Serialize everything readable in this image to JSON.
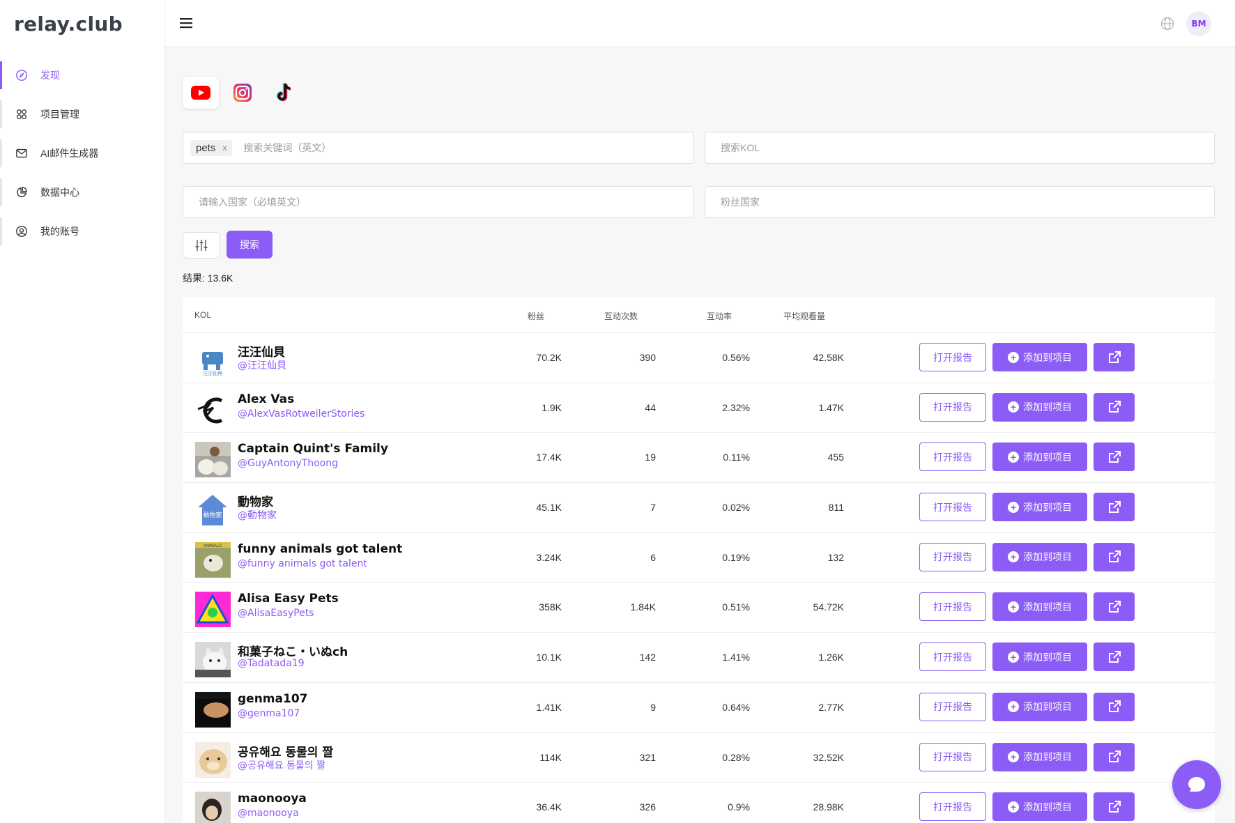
{
  "app": {
    "logo": "relay.club",
    "avatar_initials": "BM",
    "accent": "#8b5cf6"
  },
  "sidebar": {
    "items": [
      {
        "label": "发现",
        "icon": "compass-icon",
        "active": true
      },
      {
        "label": "项目管理",
        "icon": "grid-icon",
        "active": false
      },
      {
        "label": "AI邮件生成器",
        "icon": "mail-icon",
        "active": false
      },
      {
        "label": "数据中心",
        "icon": "pie-chart-icon",
        "active": false
      },
      {
        "label": "我的账号",
        "icon": "user-circle-icon",
        "active": false
      }
    ]
  },
  "platforms": [
    {
      "name": "youtube-icon",
      "selected": true
    },
    {
      "name": "instagram-icon",
      "selected": false
    },
    {
      "name": "tiktok-icon",
      "selected": false
    }
  ],
  "search": {
    "keyword_tag": "pets",
    "keyword_tag_remove": "x",
    "keyword_placeholder": "搜索关键词（英文）",
    "kol_placeholder": "搜索KOL",
    "country_placeholder": "请输入国家（必填英文）",
    "fans_country_placeholder": "粉丝国家",
    "search_button": "搜索"
  },
  "results_text": "结果: 13.6K",
  "table": {
    "headers": {
      "kol": "KOL",
      "fans": "粉丝",
      "engagements": "互动次数",
      "rate": "互动率",
      "avg_views": "平均观看量"
    },
    "action_labels": {
      "report": "打开报告",
      "add": "添加到项目"
    },
    "rows": [
      {
        "name": "汪汪仙貝",
        "handle": "@汪汪仙貝",
        "fans": "70.2K",
        "engagements": "390",
        "rate": "0.56%",
        "avg_views": "42.58K"
      },
      {
        "name": "Alex Vas",
        "handle": "@AlexVasRotweilerStories",
        "fans": "1.9K",
        "engagements": "44",
        "rate": "2.32%",
        "avg_views": "1.47K"
      },
      {
        "name": "Captain Quint's Family",
        "handle": "@GuyAntonyThoong",
        "fans": "17.4K",
        "engagements": "19",
        "rate": "0.11%",
        "avg_views": "455"
      },
      {
        "name": "動物家",
        "handle": "@動物家",
        "fans": "45.1K",
        "engagements": "7",
        "rate": "0.02%",
        "avg_views": "811"
      },
      {
        "name": "funny animals got talent",
        "handle": "@funny animals got talent",
        "fans": "3.24K",
        "engagements": "6",
        "rate": "0.19%",
        "avg_views": "132"
      },
      {
        "name": "Alisa Easy Pets",
        "handle": "@AlisaEasyPets",
        "fans": "358K",
        "engagements": "1.84K",
        "rate": "0.51%",
        "avg_views": "54.72K"
      },
      {
        "name": "和菓子ねこ・いぬch",
        "handle": "@Tadatada19",
        "fans": "10.1K",
        "engagements": "142",
        "rate": "1.41%",
        "avg_views": "1.26K"
      },
      {
        "name": "genma107",
        "handle": "@genma107",
        "fans": "1.41K",
        "engagements": "9",
        "rate": "0.64%",
        "avg_views": "2.77K"
      },
      {
        "name": "공유해요 동물의 짤",
        "handle": "@공유해요 동물의 짤",
        "fans": "114K",
        "engagements": "321",
        "rate": "0.28%",
        "avg_views": "32.52K"
      },
      {
        "name": "maonooya",
        "handle": "@maonooya",
        "fans": "36.4K",
        "engagements": "326",
        "rate": "0.9%",
        "avg_views": "28.98K"
      }
    ]
  }
}
